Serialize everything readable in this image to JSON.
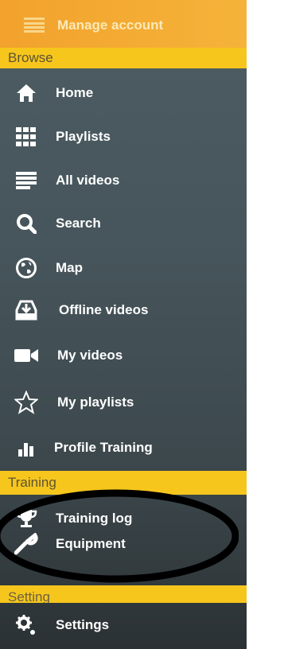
{
  "header": {
    "title": "Manage account",
    "icon": "list-icon"
  },
  "sections": {
    "browse": "Browse",
    "training": "Training",
    "settings_partial": "Setting"
  },
  "browse_items": [
    {
      "label": "Home",
      "icon": "home-icon"
    },
    {
      "label": "Playlists",
      "icon": "grid-icon"
    },
    {
      "label": "All videos",
      "icon": "list-icon"
    },
    {
      "label": "Search",
      "icon": "search-icon"
    },
    {
      "label": "Map",
      "icon": "globe-icon"
    },
    {
      "label": "Offline videos",
      "icon": "download-icon"
    },
    {
      "label": "My videos",
      "icon": "video-camera-icon"
    },
    {
      "label": "My playlists",
      "icon": "star-icon"
    },
    {
      "label": "Profile Training",
      "icon": "bar-chart-icon"
    }
  ],
  "training_items": [
    {
      "label": "Training log",
      "icon": "trophy-icon"
    },
    {
      "label": "Equipment",
      "icon": "wrench-icon"
    }
  ],
  "settings_items": [
    {
      "label": "Settings",
      "icon": "gear-icon"
    }
  ],
  "colors": {
    "header": "#f4ac33",
    "section_bar": "#f6c61d",
    "menu_bg": "#4a585e",
    "label": "#ffffff",
    "annotation": "#000000"
  }
}
